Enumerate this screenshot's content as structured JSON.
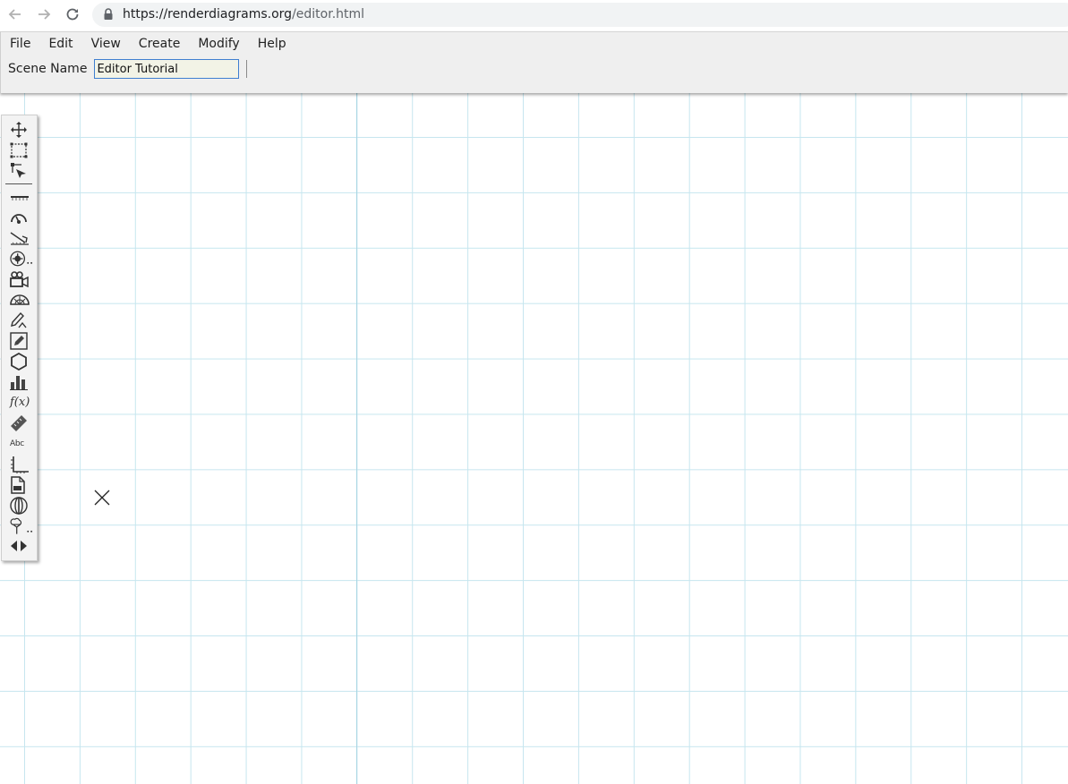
{
  "browser": {
    "url_domain": "https://renderdiagrams.org",
    "url_path": "/editor.html"
  },
  "menubar": {
    "items": [
      "File",
      "Edit",
      "View",
      "Create",
      "Modify",
      "Help"
    ]
  },
  "scene": {
    "label": "Scene Name",
    "value": "Editor Tutorial"
  },
  "toolbar": {
    "tools": [
      "move-icon",
      "rectangle-select-icon",
      "pointer-select-icon",
      "line-icon",
      "meter-icon",
      "vector-arrow-icon",
      "gear-more-icon",
      "camera-icon",
      "protractor-icon",
      "pencil-icon",
      "edit-box-icon",
      "hexagon-icon",
      "bar-chart-icon",
      "function-icon",
      "ruler-icon",
      "text-icon",
      "axes-icon",
      "document-icon",
      "globe-icon",
      "tree-more-icon",
      "expand-arrows-icon"
    ],
    "function_glyph": "f(x)",
    "text_glyph": "Abc"
  },
  "colors": {
    "grid": "#c6e6ef",
    "header_bg": "#efefef",
    "input_bg": "#f2f3e6",
    "input_border": "#3f7fd0"
  }
}
